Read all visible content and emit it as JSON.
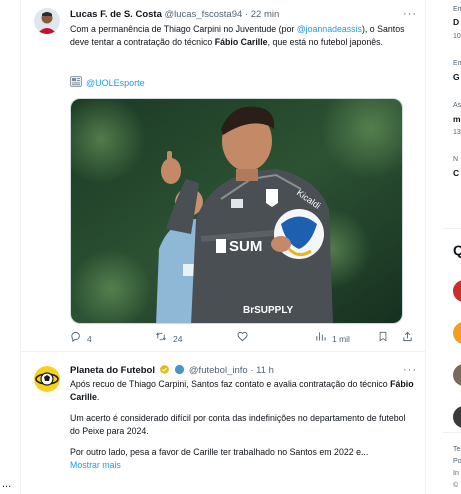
{
  "tweets": [
    {
      "author_name": "Lucas F. de S. Costa",
      "handle": "@lucas_fscosta94",
      "time": "22 min",
      "text_before_mention": "Com a permanência de Thiago Carpini no Juventude (por ",
      "mention": "@joannadeassis",
      "text_after_mention": "), o Santos deve tentar a contratação do técnico ",
      "bold_name": "Fábio Carille",
      "text_end": ", que está no futebol japonês.",
      "source_icon": "newspaper-emoji-icon",
      "source": "@UOLEsporte",
      "media_alt": "Photo of coach in Santos grey training shirt holding a ball",
      "replies": "4",
      "retweets": "24",
      "likes": "",
      "views": "1 mil"
    },
    {
      "author_name": "Planeta do Futebol",
      "handle": "@futebol_info",
      "time": "11 h",
      "para1_before": "Após recuo de Thiago Carpini, Santos faz contato e avalia contratação do técnico ",
      "para1_bold": "Fábio Carille",
      "para1_after": ".",
      "para2": "Um acerto é considerado difícil por conta das indefinições no departamento de futebol do Peixe para 2024.",
      "para3": "Por outro lado, pesa a favor de Carille ter trabalhado no Santos em 2022 e...",
      "show_more": "Mostrar mais"
    }
  ],
  "sidebar": {
    "line1": "Em",
    "line2": "D",
    "line3": "10",
    "line4": "Em",
    "line5": "G",
    "line6": "As",
    "line7": "m",
    "line8": "13",
    "line9": "N",
    "line10": "C",
    "heading": "Q",
    "footer1": "Te",
    "footer2": "Po",
    "footer3": "In",
    "footer4": "©"
  },
  "left_more": "...",
  "colors": {
    "accent": "#1d9bf0",
    "text": "#0f1419",
    "muted": "#536471",
    "border": "#eff3f4",
    "verified_gold": "#e2b719"
  }
}
